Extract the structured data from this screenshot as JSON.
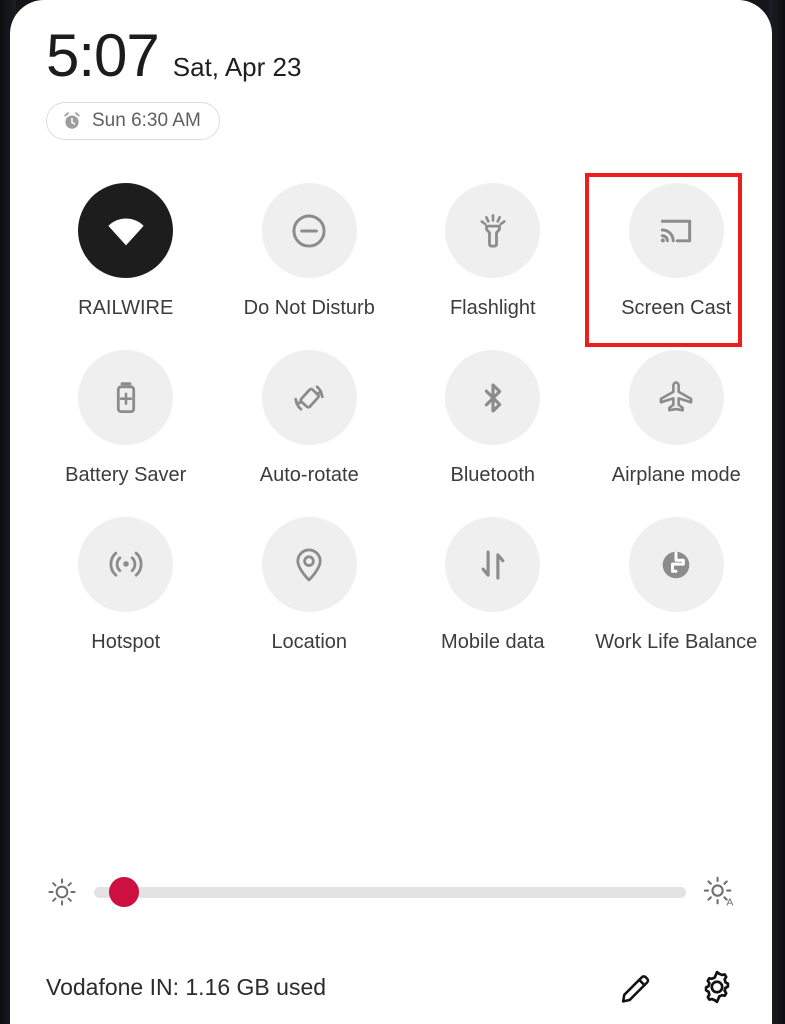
{
  "status": {
    "time": "5:07",
    "date": "Sat, Apr 23",
    "alarm": "Sun 6:30 AM",
    "alarm_icon": "alarm-clock-icon"
  },
  "tiles": [
    {
      "label": "RAILWIRE",
      "icon": "wifi-icon",
      "state": "on"
    },
    {
      "label": "Do Not Disturb",
      "icon": "do-not-disturb-icon",
      "state": "off"
    },
    {
      "label": "Flashlight",
      "icon": "flashlight-icon",
      "state": "off"
    },
    {
      "label": "Screen Cast",
      "icon": "screen-cast-icon",
      "state": "off"
    },
    {
      "label": "Battery Saver",
      "icon": "battery-saver-icon",
      "state": "off"
    },
    {
      "label": "Auto-rotate",
      "icon": "auto-rotate-icon",
      "state": "off"
    },
    {
      "label": "Bluetooth",
      "icon": "bluetooth-icon",
      "state": "off"
    },
    {
      "label": "Airplane mode",
      "icon": "airplane-icon",
      "state": "off"
    },
    {
      "label": "Hotspot",
      "icon": "hotspot-icon",
      "state": "off"
    },
    {
      "label": "Location",
      "icon": "location-pin-icon",
      "state": "off"
    },
    {
      "label": "Mobile data",
      "icon": "mobile-data-icon",
      "state": "off"
    },
    {
      "label": "Work Life Balance",
      "icon": "work-life-balance-icon",
      "state": "off"
    }
  ],
  "highlight": {
    "target_label": "Screen Cast",
    "color": "#f01c1c"
  },
  "brightness": {
    "value_percent": 5,
    "low_icon": "brightness-low-icon",
    "auto_icon": "brightness-auto-icon",
    "thumb_color": "#cc1040",
    "track_color": "#e3e3e3"
  },
  "footer": {
    "data_usage": "Vodafone IN: 1.16 GB used",
    "edit_icon": "pencil-icon",
    "settings_icon": "gear-icon"
  },
  "theme": {
    "tile_off_bg": "#efefef",
    "tile_on_bg": "#1d1d1d",
    "icon_color": "#8c8c8c"
  }
}
